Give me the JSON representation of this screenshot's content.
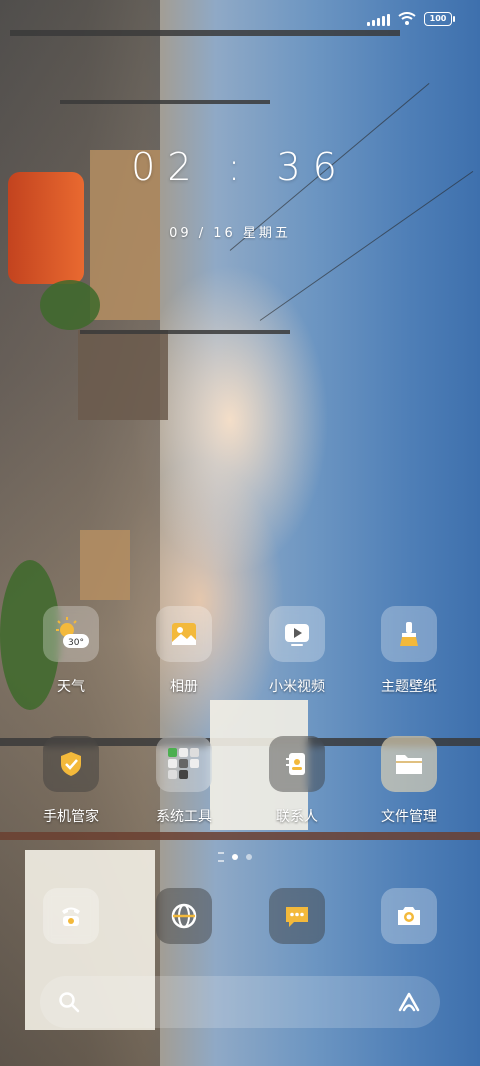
{
  "status": {
    "battery": "100"
  },
  "clock": {
    "time": "02 : 36",
    "date": "09 / 16  星期五"
  },
  "apps": {
    "row1": [
      {
        "label": "天气",
        "icon": "weather-icon"
      },
      {
        "label": "相册",
        "icon": "gallery-icon"
      },
      {
        "label": "小米视频",
        "icon": "video-icon"
      },
      {
        "label": "主题壁纸",
        "icon": "themes-icon"
      }
    ],
    "row2": [
      {
        "label": "手机管家",
        "icon": "security-icon"
      },
      {
        "label": "系统工具",
        "icon": "tools-folder-icon"
      },
      {
        "label": "联系人",
        "icon": "contacts-icon"
      },
      {
        "label": "文件管理",
        "icon": "file-manager-icon"
      }
    ]
  },
  "weather_badge": "30°",
  "dock": [
    {
      "icon": "phone-icon"
    },
    {
      "icon": "browser-icon"
    },
    {
      "icon": "messages-icon"
    },
    {
      "icon": "camera-icon"
    }
  ],
  "colors": {
    "accent_yellow": "#f3b93b",
    "tile_bg": "rgba(255,255,255,0.28)"
  }
}
